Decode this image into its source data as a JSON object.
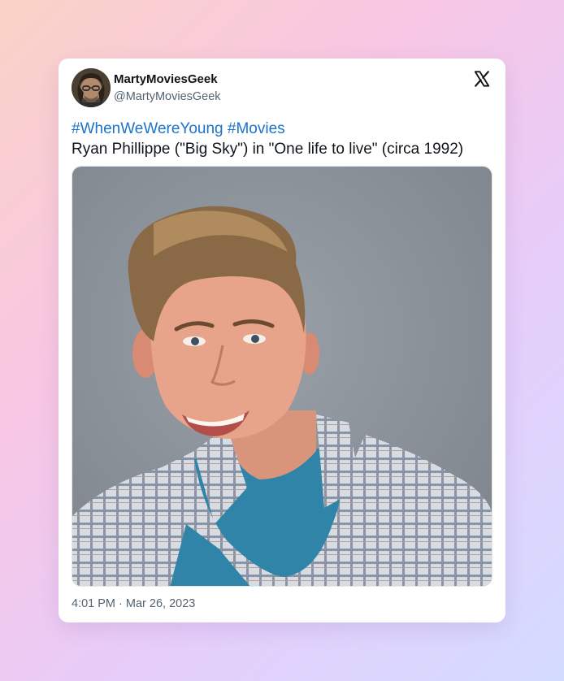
{
  "tweet": {
    "display_name": "MartyMoviesGeek",
    "handle": "@MartyMoviesGeek",
    "hashtags": [
      "#WhenWeWereYoung",
      "#Movies"
    ],
    "text": "Ryan Phillippe (\"Big Sky\") in \"One life to live\" (circa 1992)",
    "time": "4:01 PM",
    "separator": "·",
    "date": "Mar 26, 2023"
  },
  "icons": {
    "platform": "x-logo-icon",
    "avatar": "avatar-image"
  },
  "colors": {
    "hashtag": "#1d73c9",
    "name": "#0f1419",
    "secondary": "#536471",
    "photo_background": "#8f959d"
  }
}
